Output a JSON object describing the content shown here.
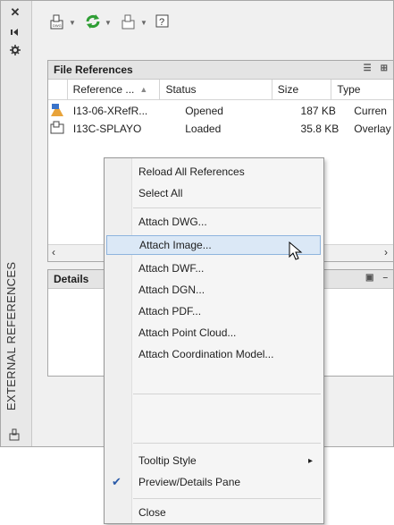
{
  "palette": {
    "vertical_title": "EXTERNAL REFERENCES",
    "titlebar_icons": [
      "close-icon",
      "auto-hide-icon",
      "properties-icon"
    ]
  },
  "toolbar": {
    "icons": [
      "attach-dwg-icon",
      "refresh-icon",
      "change-path-icon",
      "help-icon"
    ]
  },
  "file_references": {
    "title": "File References",
    "columns": [
      "Reference ...",
      "Status",
      "Size",
      "Type"
    ],
    "rows": [
      {
        "name": "I13-06-XRefR...",
        "status": "Opened",
        "size": "187 KB",
        "type": "Curren"
      },
      {
        "name": "I13C-SPLAYO",
        "status": "Loaded",
        "size": "35.8 KB",
        "type": "Overlay"
      }
    ]
  },
  "details": {
    "title": "Details"
  },
  "context_menu": {
    "items": {
      "reload_all": "Reload All References",
      "select_all": "Select All",
      "attach_dwg": "Attach DWG...",
      "attach_image": "Attach Image...",
      "attach_dwf": "Attach DWF...",
      "attach_dgn": "Attach DGN...",
      "attach_pdf": "Attach PDF...",
      "attach_point_cloud": "Attach Point Cloud...",
      "attach_coordination": "Attach Coordination Model...",
      "tooltip_style": "Tooltip Style",
      "preview_details": "Preview/Details Pane",
      "close": "Close"
    },
    "highlighted": "Attach Image...",
    "checked": "Preview/Details Pane",
    "checkmark": "✔",
    "submenu_arrow": "▸"
  },
  "colors": {
    "highlight_fill": "#dbe8f6",
    "highlight_border": "#8eb4de",
    "refresh_green": "#2e9e34"
  }
}
